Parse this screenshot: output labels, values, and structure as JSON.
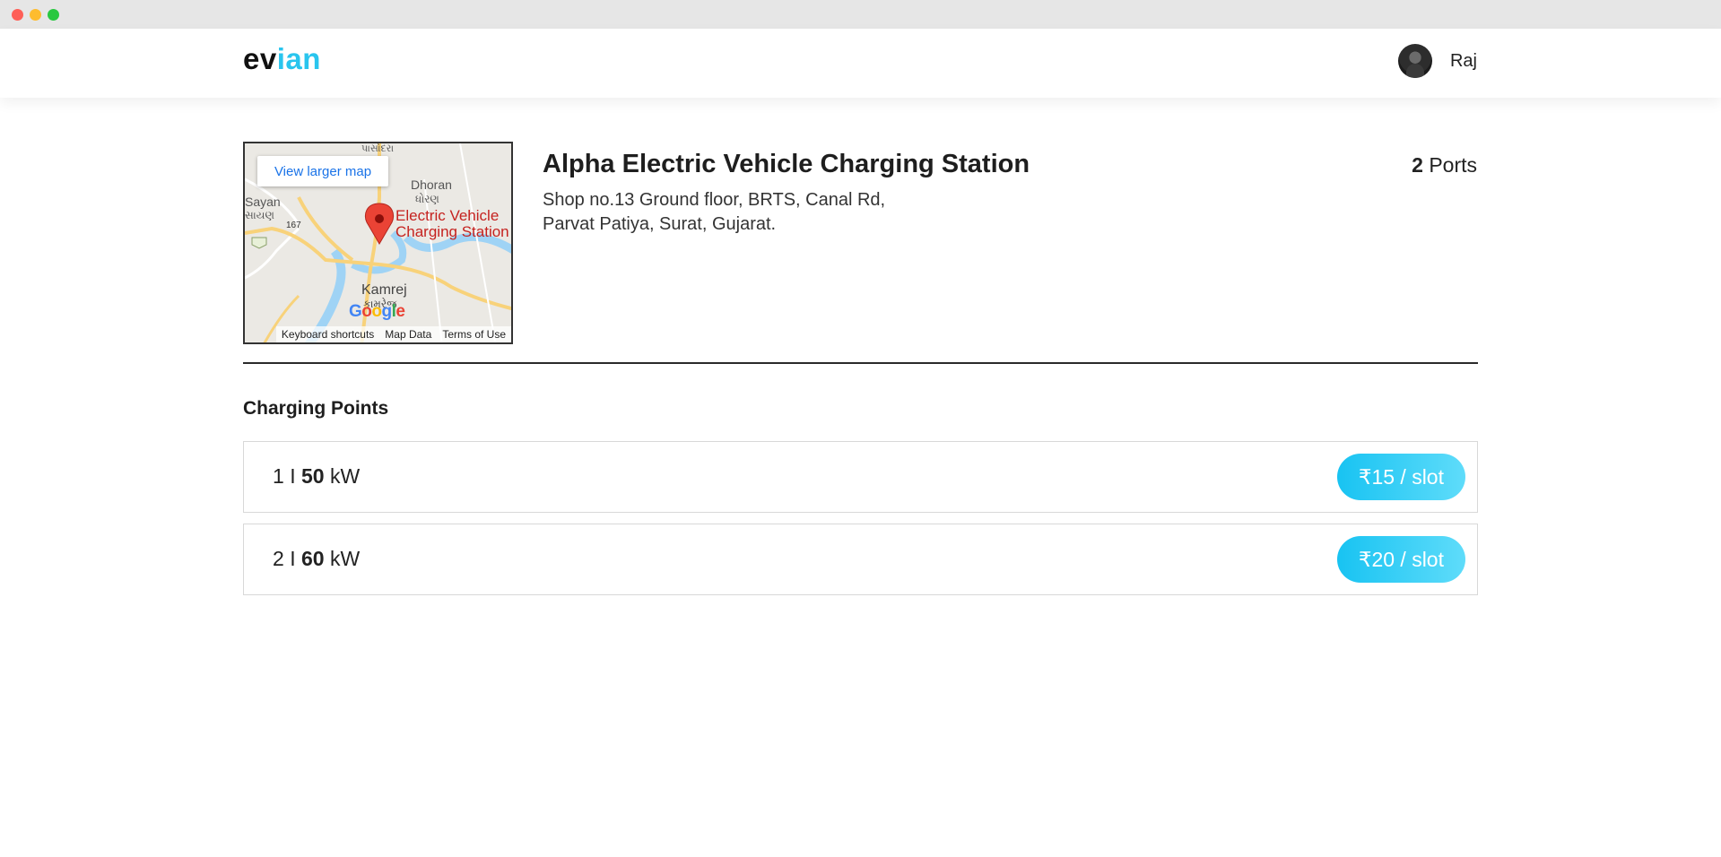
{
  "brand": {
    "logo_part1": "ev",
    "logo_part2": "ian"
  },
  "user": {
    "name": "Raj"
  },
  "map": {
    "view_larger_label": "View larger map",
    "labels": {
      "dhoran": "Dhoran",
      "dhoran_gu": "ધોરણ",
      "sayan": "Sayan",
      "sayan_gu": "સાયણ",
      "route": "167",
      "kamrej": "Kamrej",
      "kamrej_gu": "કામરેજ",
      "top_gu": "પાસોદરા"
    },
    "poi_line1": "Electric Vehicle",
    "poi_line2": "Charging Station",
    "footer": {
      "keyboard": "Keyboard shortcuts",
      "map_data": "Map Data",
      "terms": "Terms of Use"
    },
    "google_logo_letters": [
      "G",
      "o",
      "o",
      "g",
      "l",
      "e"
    ]
  },
  "station": {
    "name": "Alpha Electric Vehicle Charging Station",
    "address_line1": "Shop no.13 Ground floor, BRTS, Canal Rd,",
    "address_line2": "Parvat Patiya, Surat, Gujarat.",
    "ports_count": "2",
    "ports_label": "Ports"
  },
  "charging": {
    "title": "Charging Points",
    "points": [
      {
        "number": "1",
        "separator": "I",
        "power": "50",
        "unit": "kW",
        "price": "₹15 / slot"
      },
      {
        "number": "2",
        "separator": "I",
        "power": "60",
        "unit": "kW",
        "price": "₹20 / slot"
      }
    ]
  },
  "colors": {
    "accent": "#29c5ee",
    "button_gradient_start": "#18c3f2",
    "button_gradient_end": "#5fdcfa",
    "poi_red": "#c5221f"
  }
}
